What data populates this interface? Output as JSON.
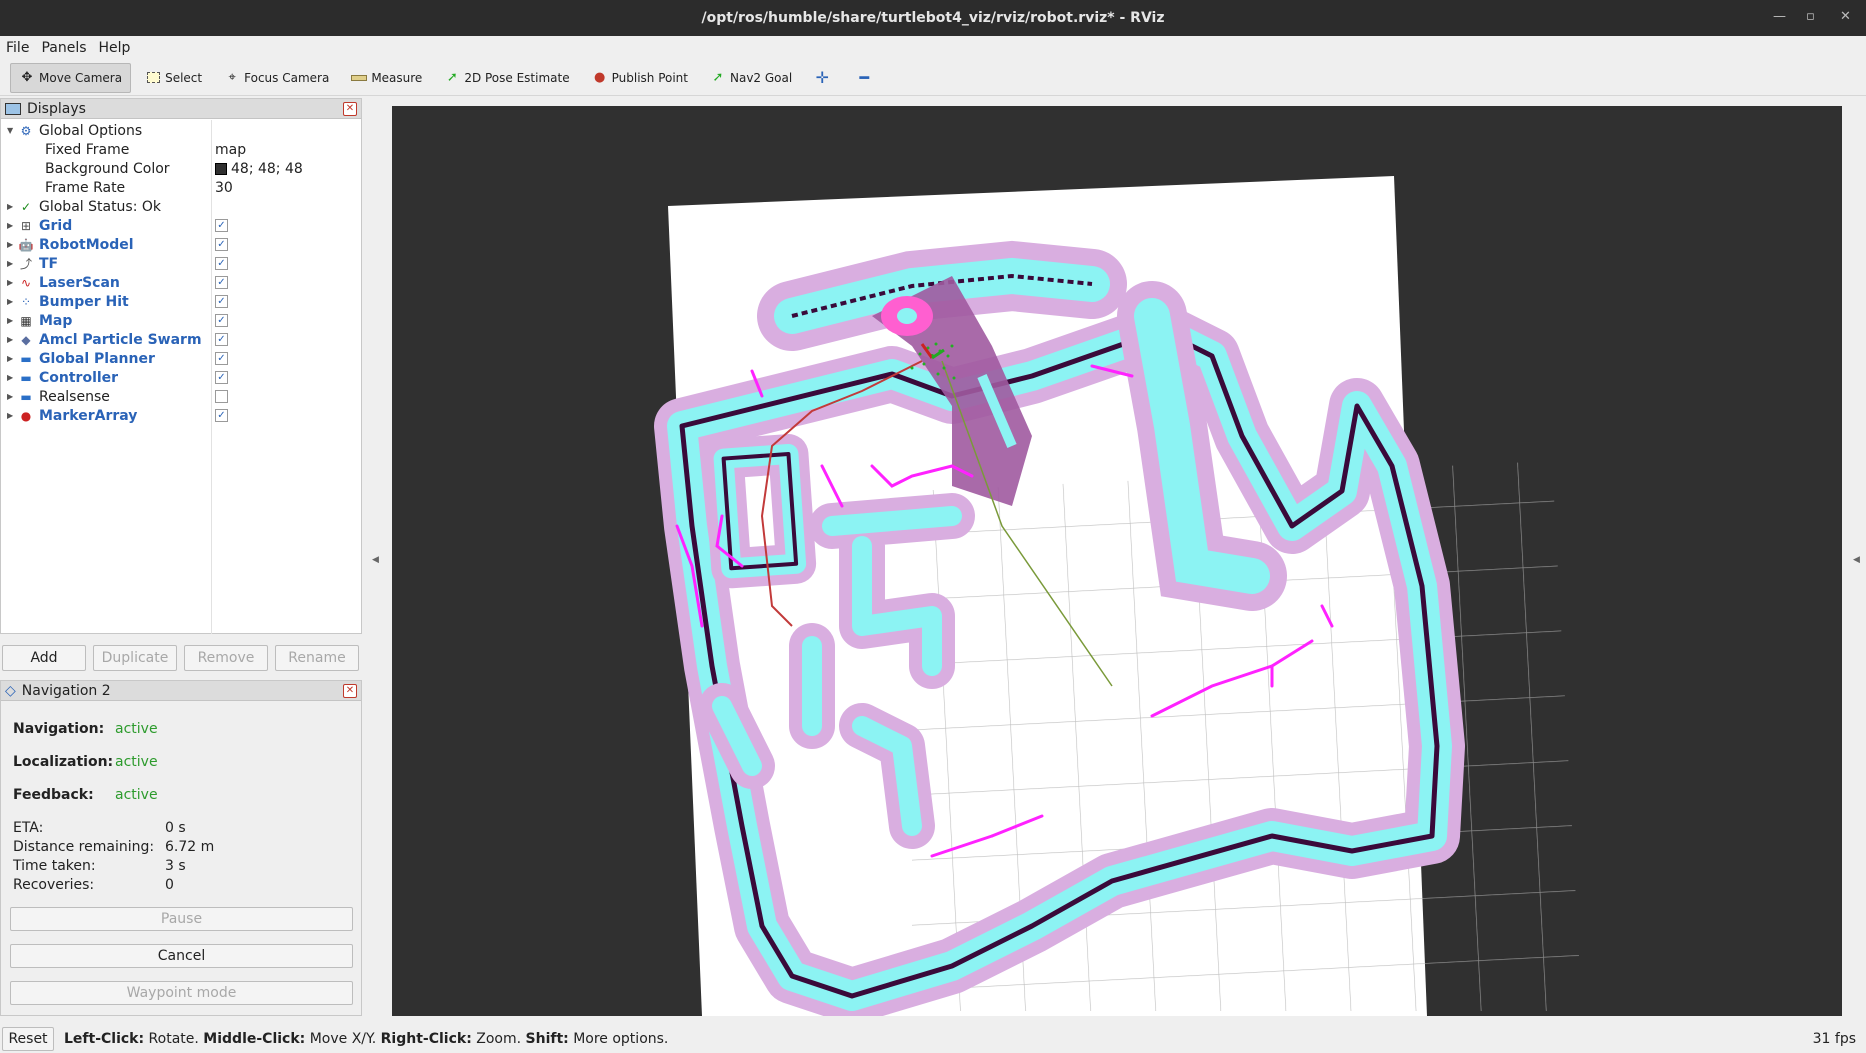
{
  "window": {
    "title": "/opt/ros/humble/share/turtlebot4_viz/rviz/robot.rviz* - RViz"
  },
  "menu": [
    "File",
    "Panels",
    "Help"
  ],
  "toolbar": [
    {
      "label": "Move Camera",
      "icon": "move-camera-icon"
    },
    {
      "label": "Select",
      "icon": "select-icon"
    },
    {
      "label": "Focus Camera",
      "icon": "focus-camera-icon"
    },
    {
      "label": "Measure",
      "icon": "measure-icon"
    },
    {
      "label": "2D Pose Estimate",
      "icon": "pose-estimate-icon"
    },
    {
      "label": "Publish Point",
      "icon": "publish-point-icon"
    },
    {
      "label": "Nav2 Goal",
      "icon": "nav2-goal-icon"
    }
  ],
  "displays": {
    "title": "Displays",
    "global_options": "Global Options",
    "fixed_frame_label": "Fixed Frame",
    "fixed_frame_value": "map",
    "background_color_label": "Background Color",
    "background_color_value": "48; 48; 48",
    "background_color_swatch": "#303030",
    "frame_rate_label": "Frame Rate",
    "frame_rate_value": "30",
    "global_status": "Global Status: Ok",
    "items": [
      {
        "label": "Grid",
        "checked": true,
        "icon": "grid-icon"
      },
      {
        "label": "RobotModel",
        "checked": true,
        "icon": "robot-model-icon"
      },
      {
        "label": "TF",
        "checked": true,
        "icon": "tf-icon"
      },
      {
        "label": "LaserScan",
        "checked": true,
        "icon": "laser-scan-icon"
      },
      {
        "label": "Bumper Hit",
        "checked": true,
        "icon": "bumper-hit-icon"
      },
      {
        "label": "Map",
        "checked": true,
        "icon": "map-icon"
      },
      {
        "label": "Amcl Particle Swarm",
        "checked": true,
        "icon": "particle-swarm-icon"
      },
      {
        "label": "Global Planner",
        "checked": true,
        "icon": "folder-icon"
      },
      {
        "label": "Controller",
        "checked": true,
        "icon": "folder-icon"
      },
      {
        "label": "Realsense",
        "checked": false,
        "icon": "folder-icon"
      },
      {
        "label": "MarkerArray",
        "checked": true,
        "icon": "marker-array-icon"
      }
    ],
    "buttons": {
      "add": "Add",
      "duplicate": "Duplicate",
      "remove": "Remove",
      "rename": "Rename"
    }
  },
  "nav2": {
    "title": "Navigation 2",
    "navigation_label": "Navigation:",
    "navigation_value": "active",
    "localization_label": "Localization:",
    "localization_value": "active",
    "feedback_label": "Feedback:",
    "feedback_value": "active",
    "eta_label": "ETA:",
    "eta_value": "0 s",
    "distance_label": "Distance remaining:",
    "distance_value": "6.72 m",
    "time_label": "Time taken:",
    "time_value": "3 s",
    "recoveries_label": "Recoveries:",
    "recoveries_value": "0",
    "pause": "Pause",
    "cancel": "Cancel",
    "waypoint": "Waypoint mode"
  },
  "status": {
    "reset": "Reset",
    "left_click_key": "Left-Click:",
    "left_click_val": "Rotate.",
    "middle_click_key": "Middle-Click:",
    "middle_click_val": "Move X/Y.",
    "right_click_key": "Right-Click:",
    "right_click_val": "Zoom.",
    "shift_key": "Shift:",
    "shift_val": "More options.",
    "fps": "31 fps"
  },
  "colors": {
    "viewport_bg": "#303030",
    "map_free": "#ffffff",
    "inflation_outer": "#d8a8dc",
    "inflation_inner": "#8af0f0",
    "wall": "#3a0a3a",
    "laser": "#ff22ff",
    "path": "#d23a3a"
  }
}
